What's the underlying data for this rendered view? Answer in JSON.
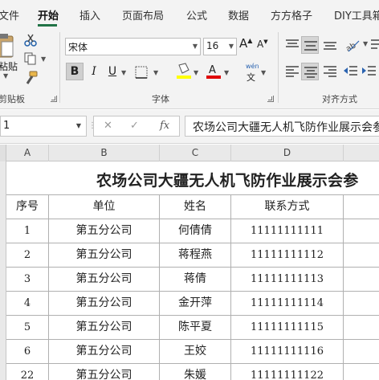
{
  "ribbon_tabs": [
    "文件",
    "开始",
    "插入",
    "页面布局",
    "公式",
    "数据",
    "方方格子",
    "DIY工具箱"
  ],
  "active_tab": "开始",
  "clipboard": {
    "paste_label": "粘贴",
    "group_label": "剪贴板"
  },
  "font": {
    "name": "宋体",
    "size": "16",
    "bold": "B",
    "italic": "I",
    "underline": "U",
    "group_label": "字体",
    "wen_label": "wén",
    "wen_char": "文",
    "grow_label": "A",
    "shrink_label": "A"
  },
  "alignment": {
    "group_label": "对齐方式"
  },
  "accent_color": "#217346",
  "fill_color": "#ffff00",
  "font_color": "#e00000",
  "formula_bar": {
    "name_box": "1",
    "cancel_symbol": "✕",
    "enter_symbol": "✓",
    "fx_label": "fx",
    "formula": "农场公司大疆无人机飞防作业展示会参"
  },
  "columns": [
    "A",
    "B",
    "C",
    "D"
  ],
  "sheet_title": "农场公司大疆无人机飞防作业展示会参",
  "table": {
    "headers": [
      "序号",
      "单位",
      "姓名",
      "联系方式"
    ],
    "rows": [
      [
        "1",
        "第五分公司",
        "何倩倩",
        "11111111111"
      ],
      [
        "2",
        "第五分公司",
        "蒋程燕",
        "11111111112"
      ],
      [
        "3",
        "第五分公司",
        "蒋倩",
        "11111111113"
      ],
      [
        "4",
        "第五分公司",
        "金开萍",
        "11111111114"
      ],
      [
        "5",
        "第五分公司",
        "陈平夏",
        "11111111115"
      ],
      [
        "6",
        "第五分公司",
        "王姣",
        "11111111116"
      ],
      [
        "22",
        "第五分公司",
        "朱媛",
        "11111111122"
      ]
    ]
  }
}
